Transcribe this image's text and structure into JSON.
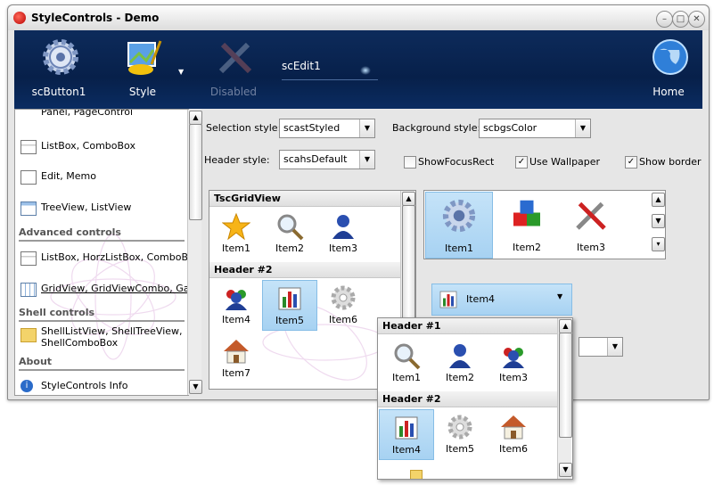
{
  "window": {
    "title": "StyleControls - Demo"
  },
  "toolbar": {
    "button1": "scButton1",
    "style": "Style",
    "disabled": "Disabled",
    "edit": "scEdit1",
    "home": "Home"
  },
  "sidebar": {
    "items_top": [
      "Panel, PageControl",
      "ListBox, ComboBox",
      "Edit, Memo",
      "TreeView, ListView"
    ],
    "headers": [
      "Advanced controls",
      "Shell controls",
      "About"
    ],
    "advanced": [
      "ListBox, HorzListBox, ComboBox",
      "GridView, GridViewCombo, Gallery"
    ],
    "shell": [
      "ShellListView, ShellTreeView,",
      "ShellComboBox"
    ],
    "about": "StyleControls Info"
  },
  "options": {
    "selection_label": "Selection style:",
    "selection_value": "scastStyled",
    "background_label": "Background style:",
    "background_value": "scbgsColor",
    "header_label": "Header style:",
    "header_value": "scahsDefault",
    "show_focus_rect": "ShowFocusRect",
    "use_wallpaper": "Use Wallpaper",
    "show_border": "Show border"
  },
  "grid": {
    "title": "TscGridView",
    "header2": "Header #2",
    "items": [
      "Item1",
      "Item2",
      "Item3",
      "Item4",
      "Item5",
      "Item6",
      "Item7"
    ]
  },
  "gallery": {
    "items": [
      "Item1",
      "Item2",
      "Item3"
    ]
  },
  "combo": {
    "value": "Item4"
  },
  "dropdown": {
    "header1": "Header #1",
    "header2": "Header #2",
    "items": [
      "Item1",
      "Item2",
      "Item3",
      "Item4",
      "Item5",
      "Item6"
    ]
  },
  "colors": {
    "toolbar_bg": "#0a2652",
    "selection": "#a7d2f2",
    "window_bg": "#e6e6e6"
  }
}
